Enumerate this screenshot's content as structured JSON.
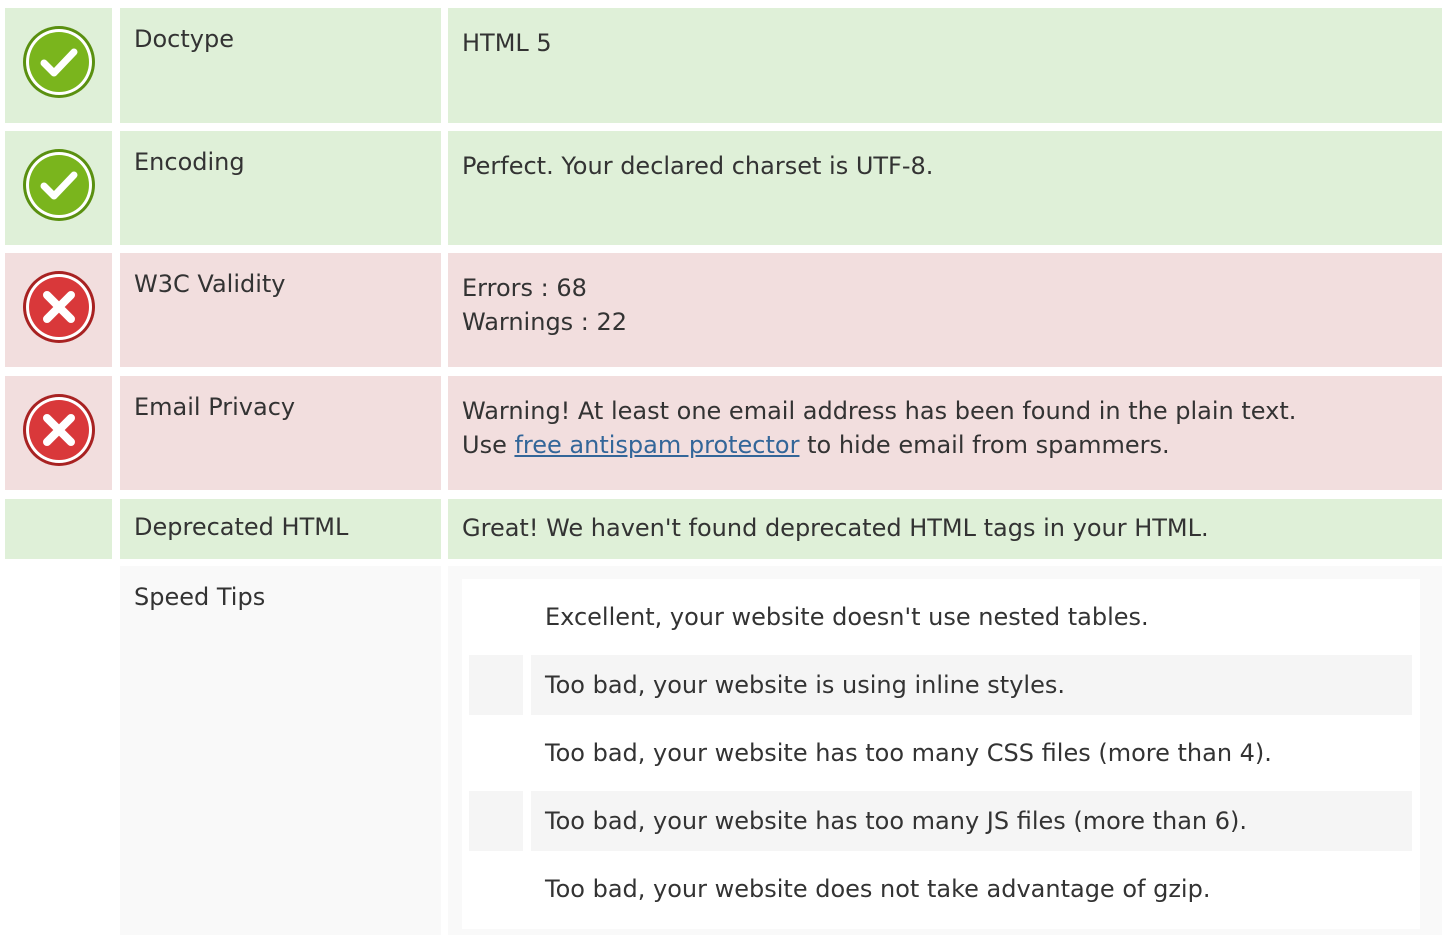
{
  "rows": [
    {
      "status": "pass",
      "label": "Doctype",
      "lines": [
        "HTML 5"
      ]
    },
    {
      "status": "pass",
      "label": "Encoding",
      "lines": [
        "Perfect. Your declared charset is UTF-8."
      ]
    },
    {
      "status": "fail",
      "label": "W3C Validity",
      "lines": [
        "Errors : 68",
        "Warnings : 22"
      ]
    },
    {
      "status": "fail",
      "label": "Email Privacy",
      "line1": "Warning! At least one email address has been found in the plain text.",
      "line2_prefix": "Use ",
      "line2_link": "free antispam protector",
      "line2_suffix": " to hide email from spammers."
    },
    {
      "status": "neutral",
      "label": "Deprecated HTML",
      "lines": [
        "Great! We haven't found deprecated HTML tags in your HTML."
      ]
    },
    {
      "status": "neutral",
      "label": "Speed Tips",
      "tips": [
        "Excellent, your website doesn't use nested tables.",
        "Too bad, your website is using inline styles.",
        "Too bad, your website has too many CSS files (more than 4).",
        "Too bad, your website has too many JS files (more than 6).",
        "Too bad, your website does not take advantage of gzip."
      ]
    }
  ],
  "icons": {
    "pass": "check-circle-icon",
    "fail": "x-circle-icon"
  },
  "colors": {
    "pass_bg": "#dff0d8",
    "fail_bg": "#f2dede",
    "neutral_bg": "#f9f9f9",
    "check_green": "#7ab51d",
    "cross_red": "#d9383a",
    "link": "#336699"
  }
}
